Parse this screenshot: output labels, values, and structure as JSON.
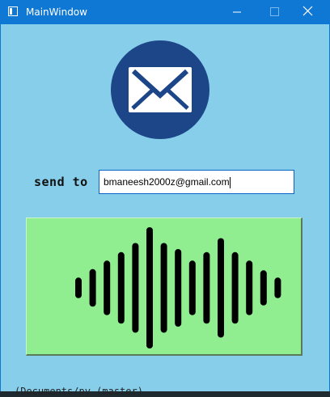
{
  "window": {
    "title": "MainWindow",
    "titlebar_color": "#0f78d4",
    "background_color": "#87ceeb"
  },
  "titlebar_controls": {
    "minimize_icon": "minimize-icon",
    "maximize_icon": "maximize-icon",
    "close_icon": "close-icon"
  },
  "badge": {
    "icon": "mail-envelope-icon",
    "circle_color": "#1d4688"
  },
  "send_to": {
    "label": "send to",
    "value": "bmaneesh2000z@gmail.com"
  },
  "voice_button": {
    "icon": "sound-wave-icon",
    "color": "#90ee90",
    "bar_levels": [
      0.17,
      0.31,
      0.45,
      0.59,
      0.74,
      1.0,
      0.74,
      0.64,
      0.45,
      0.59,
      0.82,
      0.59,
      0.45,
      0.29,
      0.17
    ]
  },
  "background_text": {
    "terminal_fragment": "(Documents/py (master)"
  }
}
